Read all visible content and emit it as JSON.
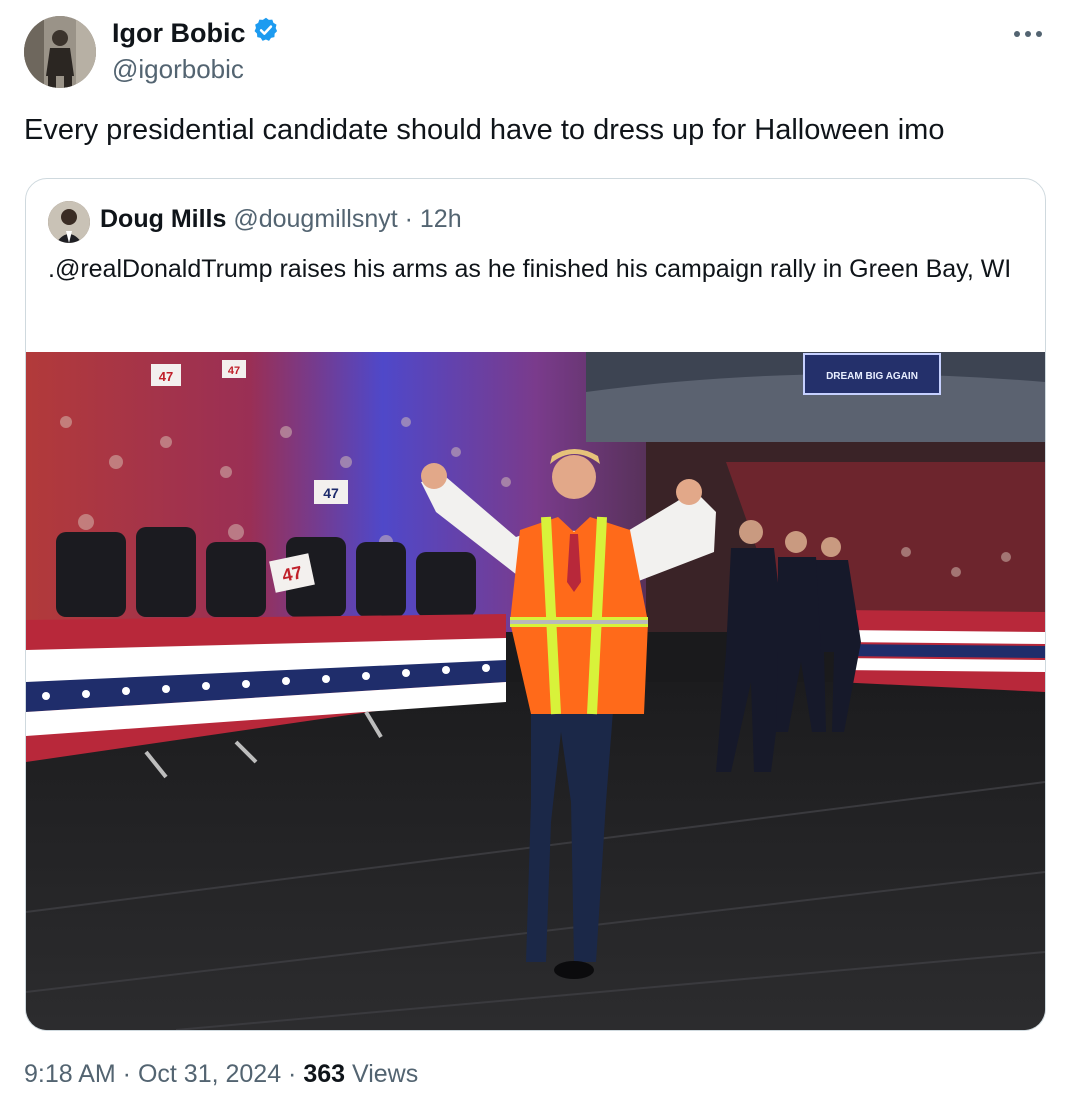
{
  "tweet": {
    "author": {
      "name": "Igor Bobic",
      "handle": "@igorbobic",
      "verified": true
    },
    "text": "Every presidential candidate should have to dress up for Halloween imo",
    "more_icon": "ellipsis-icon"
  },
  "quoted": {
    "name": "Doug Mills",
    "handle": "@dougmillsnyt",
    "sep": " · ",
    "time": "12h",
    "text": ".@realDonaldTrump raises his arms as he finished his campaign rally in Green Bay, WI",
    "media": {
      "type": "photo",
      "signs": {
        "sign_a": "47",
        "sign_b": "47",
        "sign_c": "47",
        "sign_d": "47"
      },
      "screen_text": "DREAM BIG AGAIN"
    }
  },
  "footer": {
    "time": "9:18 AM",
    "sep1": " · ",
    "date": "Oct 31, 2024",
    "sep2": " · ",
    "views_count": "363",
    "views_label": " Views"
  },
  "colors": {
    "verified_badge": "#1d9bf0",
    "text_primary": "#0f1419",
    "text_secondary": "#536471",
    "card_border": "#cfd9de",
    "vest_orange": "#ff6a1a",
    "vest_stripe": "#d8f23a"
  }
}
